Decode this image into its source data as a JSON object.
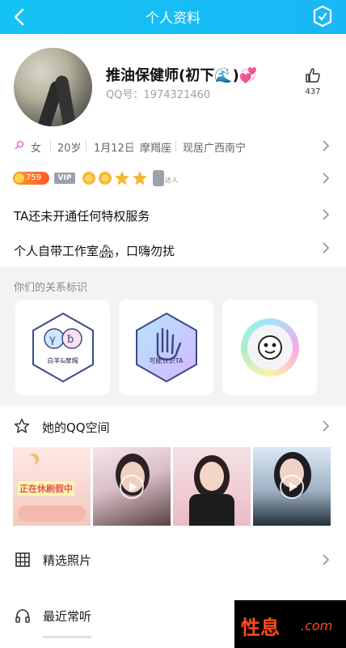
{
  "header": {
    "title": "个人资料",
    "back_icon": "back-arrow-icon",
    "right_icon": "shield-check-icon",
    "accent": "#17bdf5"
  },
  "profile": {
    "nickname": "推油保健师(初下🌊)💞",
    "qq_number": "QQ号：1974321460",
    "like_count": "437",
    "like_icon": "thumbs-up-icon"
  },
  "info": {
    "gender": "女",
    "age": "20岁",
    "birthday": "1月12日",
    "zodiac": "摩羯座",
    "location": "现居广西南宁"
  },
  "badges": {
    "coin_value": "759",
    "vip_label": "VIP",
    "extra_label": "达人"
  },
  "privilege_text": "TA还未开通任何特权服务",
  "signature_text": "个人自带工作室🏘，口嗨勿扰",
  "relations": {
    "title": "你们的关系标识",
    "cards": [
      {
        "label": "白羊&摩羯",
        "icon": "zodiac-aries-capricorn-icon"
      },
      {
        "label": "可能认识TA",
        "icon": "waving-hand-icon"
      },
      {
        "label": "",
        "icon": "smiley-face-badge-icon"
      }
    ]
  },
  "qzone": {
    "label": "她的QQ空间",
    "icon": "star-outline-icon",
    "photos": [
      {
        "text": "正在休刷假中",
        "kind": "image"
      },
      {
        "text": "",
        "kind": "video"
      },
      {
        "text": "",
        "kind": "photo"
      },
      {
        "text": "",
        "kind": "video"
      }
    ]
  },
  "selected_photos": {
    "label": "精选照片",
    "icon": "grid-icon"
  },
  "recent_music": {
    "label": "最近常听",
    "icon": "headphones-icon"
  },
  "watermark": {
    "text": "性息",
    "suffix": ".com"
  }
}
